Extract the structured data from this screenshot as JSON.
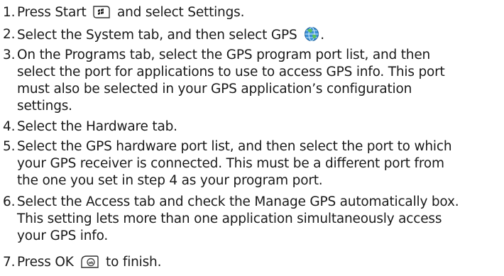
{
  "steps": [
    {
      "num": "1.",
      "before": "Press Start",
      "icon": "start-button-icon",
      "after": "and select Settings."
    },
    {
      "num": "2.",
      "before": "Select the System tab, and then select GPS",
      "icon": "gps-globe-icon",
      "after": "."
    },
    {
      "num": "3.",
      "lines": [
        "On the Programs tab, select the GPS program port list, and then",
        "select the port for applications to use to access GPS info. This port",
        "must also be selected in your GPS application’s configuration",
        "settings."
      ]
    },
    {
      "num": "4.",
      "lines": [
        "Select the Hardware tab."
      ]
    },
    {
      "num": "5.",
      "lines": [
        "Select the GPS hardware port list, and then select the port to which",
        "your GPS receiver is connected. This must be a different port from",
        "the one you set in step 4 as your program port."
      ]
    },
    {
      "num": "6.",
      "lines": [
        "Select the Access tab and check the Manage GPS automatically box.",
        "This setting lets more than one application simultaneously access",
        "your GPS info."
      ]
    },
    {
      "num": "7.",
      "before": "Press OK",
      "icon": "ok-button-icon",
      "after": "to finish."
    }
  ]
}
